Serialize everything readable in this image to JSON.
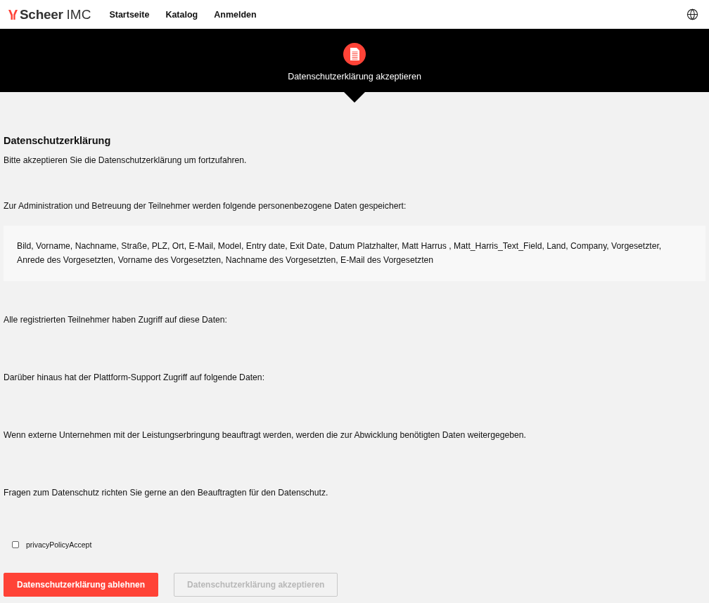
{
  "header": {
    "logo": {
      "brand": "Scheer",
      "suffix": "IMC"
    },
    "nav": [
      {
        "label": "Startseite"
      },
      {
        "label": "Katalog"
      },
      {
        "label": "Anmelden"
      }
    ]
  },
  "banner": {
    "step_label": "Datenschutzerklärung akzeptieren"
  },
  "privacy": {
    "title": "Datenschutzerklärung",
    "intro": "Bitte akzeptieren Sie die Datenschutzerklärung um fortzufahren.",
    "data_intro": "Zur Administration und Betreuung der Teilnehmer werden folgende personenbezogene Daten gespeichert:",
    "data_fields": "Bild, Vorname, Nachname, Straße, PLZ, Ort, E-Mail, Model, Entry date, Exit Date, Datum Platzhalter, Matt Harrus , Matt_Harris_Text_Field, Land, Company, Vorgesetzter, Anrede des Vorgesetzten, Vorname des Vorgesetzten, Nachname des Vorgesetzten, E-Mail des Vorgesetzten",
    "paragraphs": [
      "Alle registrierten Teilnehmer haben Zugriff auf diese Daten:",
      "Darüber hinaus hat der Plattform-Support Zugriff auf folgende Daten:",
      "Wenn externe Unternehmen mit der Leistungserbringung beauftragt werden, werden die zur Abwicklung benötigten Daten weitergegeben.",
      "Fragen zum Datenschutz richten Sie gerne an den Beauftragten für den Datenschutz."
    ]
  },
  "consent": {
    "label": "privacyPolicyAccept",
    "checked": false
  },
  "buttons": [
    {
      "label": "Datenschutzerklärung ablehnen",
      "kind": "primary",
      "disabled": false
    },
    {
      "label": "Datenschutzerklärung akzeptieren",
      "kind": "secondary",
      "disabled": true
    }
  ]
}
